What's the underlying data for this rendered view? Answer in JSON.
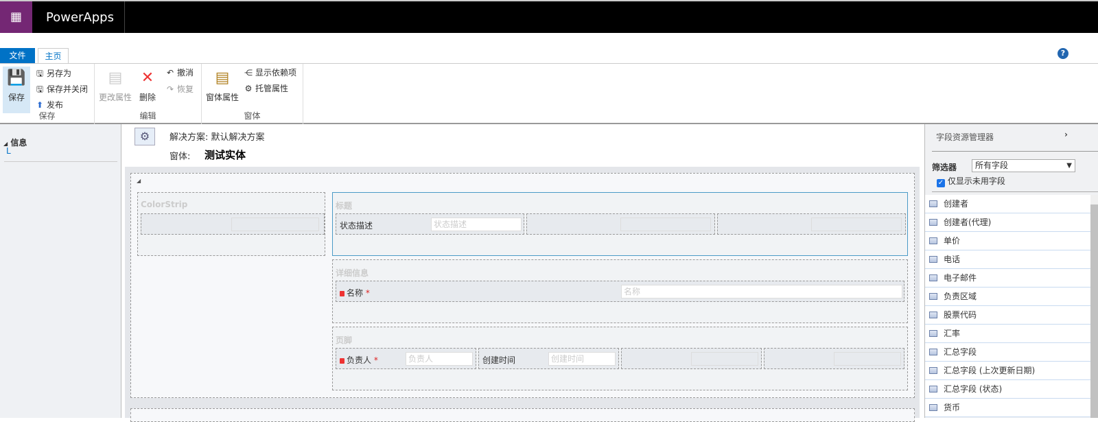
{
  "app": {
    "title": "PowerApps",
    "waffle_icon": "waffle-icon"
  },
  "tabs": {
    "file": "文件",
    "home": "主页",
    "help": "?"
  },
  "ribbon": {
    "save_group": {
      "save": "保存",
      "save_as": "另存为",
      "save_close": "保存并关闭",
      "publish": "发布",
      "label": "保存"
    },
    "edit_group": {
      "change_props": "更改属性",
      "delete": "删除",
      "undo": "撤消",
      "redo": "恢复",
      "label": "编辑"
    },
    "form_group": {
      "form_props": "窗体属性",
      "show_deps": "显示依赖项",
      "managed_props": "托管属性",
      "label": "窗体"
    }
  },
  "left_nav": {
    "section": "信息",
    "item": "L"
  },
  "header": {
    "solution": "解决方案: 默认解决方案",
    "form_label": "窗体:",
    "form_name": "测试实体"
  },
  "form": {
    "colorstrip": "ColorStrip",
    "title_section": {
      "title": "标题",
      "field_label": "状态描述",
      "field_placeholder": "状态描述"
    },
    "details_section": {
      "title": "详细信息",
      "field_label": "名称",
      "field_placeholder": "名称"
    },
    "footer_section": {
      "title": "页脚",
      "owner_label": "负责人",
      "owner_placeholder": "负责人",
      "created_label": "创建时间",
      "created_placeholder": "创建时间"
    },
    "required_mark": "*"
  },
  "field_explorer": {
    "title": "字段资源管理器",
    "filter_label": "筛选器",
    "filter_value": "所有字段",
    "unused_only_label": "仅显示未用字段",
    "unused_only_checked": true,
    "fields": [
      "创建者",
      "创建者(代理)",
      "单价",
      "电话",
      "电子邮件",
      "负责区域",
      "股票代码",
      "汇率",
      "汇总字段",
      "汇总字段 (上次更新日期)",
      "汇总字段 (状态)",
      "货币"
    ]
  }
}
